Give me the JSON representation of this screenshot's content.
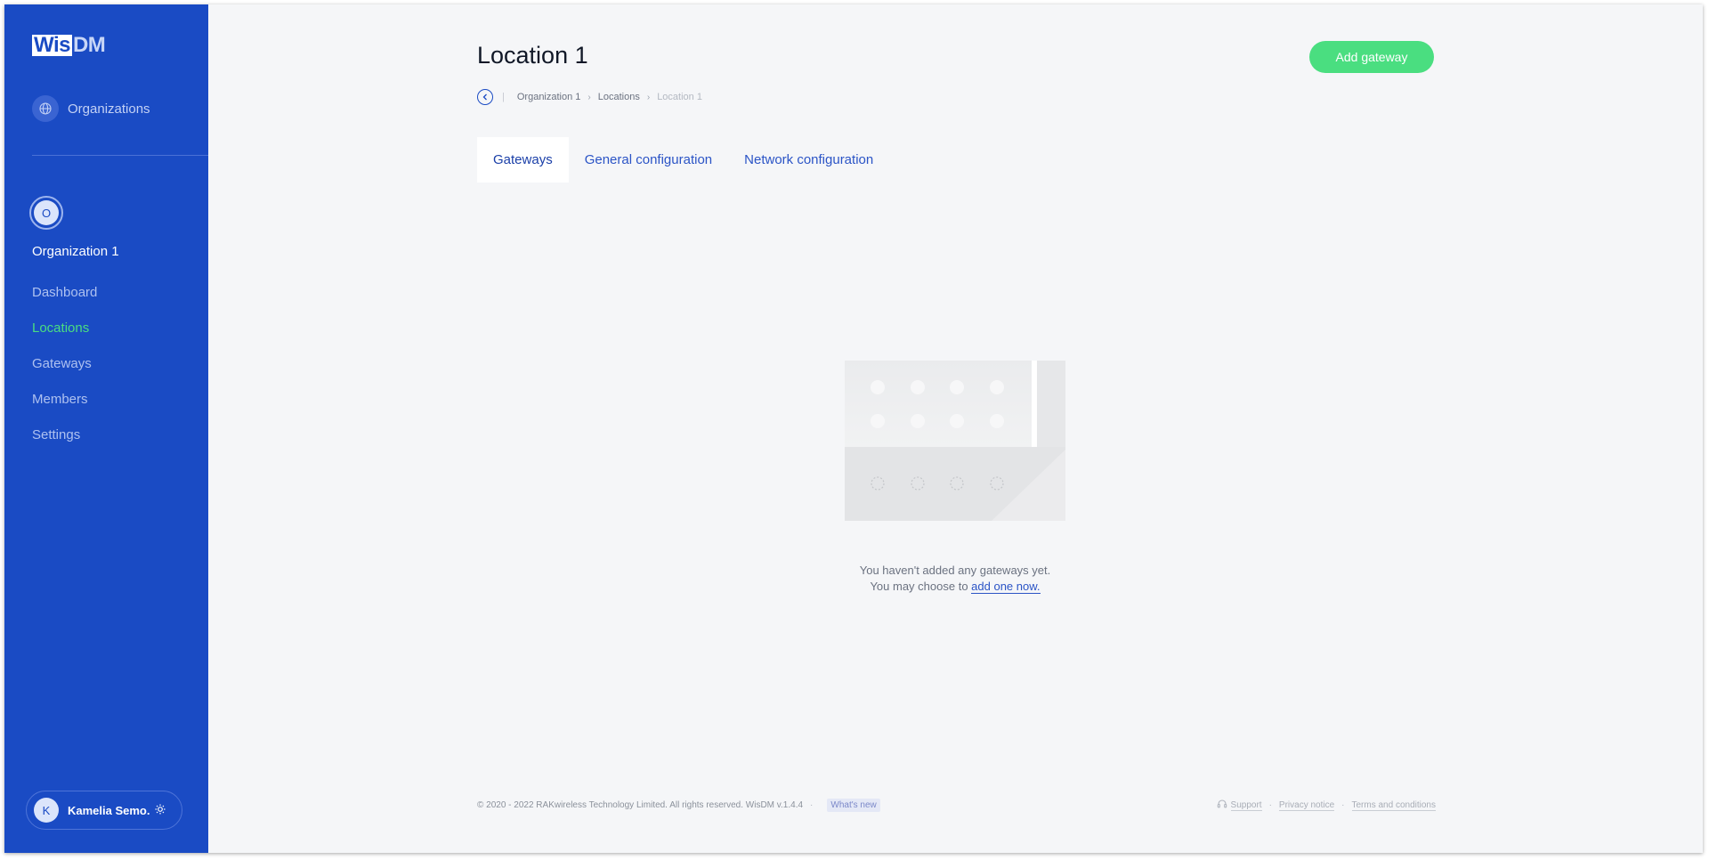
{
  "app": {
    "logo_part1": "Wis",
    "logo_part2": "DM"
  },
  "sidebar": {
    "organizations_label": "Organizations",
    "org_avatar_letter": "O",
    "org_name": "Organization 1",
    "items": [
      {
        "label": "Dashboard",
        "active": false
      },
      {
        "label": "Locations",
        "active": true
      },
      {
        "label": "Gateways",
        "active": false
      },
      {
        "label": "Members",
        "active": false
      },
      {
        "label": "Settings",
        "active": false
      }
    ],
    "user": {
      "avatar_letter": "K",
      "name": "Kamelia Semo..."
    }
  },
  "header": {
    "title": "Location 1",
    "add_button_label": "Add gateway",
    "breadcrumb": [
      "Organization 1",
      "Locations",
      "Location 1"
    ]
  },
  "tabs": [
    {
      "label": "Gateways",
      "active": true
    },
    {
      "label": "General configuration",
      "active": false
    },
    {
      "label": "Network configuration",
      "active": false
    }
  ],
  "empty_state": {
    "line1": "You haven't added any gateways yet.",
    "line2_prefix": "You may choose to ",
    "link_text": "add one now."
  },
  "footer": {
    "copyright": "© 2020 - 2022 RAKwireless Technology Limited. All rights reserved. WisDM v.1.4.4",
    "whats_new": "What's new",
    "support": "Support",
    "privacy": "Privacy notice",
    "terms": "Terms and conditions"
  },
  "colors": {
    "sidebar_bg": "#1a4bc4",
    "accent_green": "#4ade80",
    "page_bg": "#f5f6f8"
  },
  "icons": [
    "globe-icon",
    "chevron-left-icon",
    "chevron-right-icon",
    "sun-icon",
    "headset-icon"
  ]
}
